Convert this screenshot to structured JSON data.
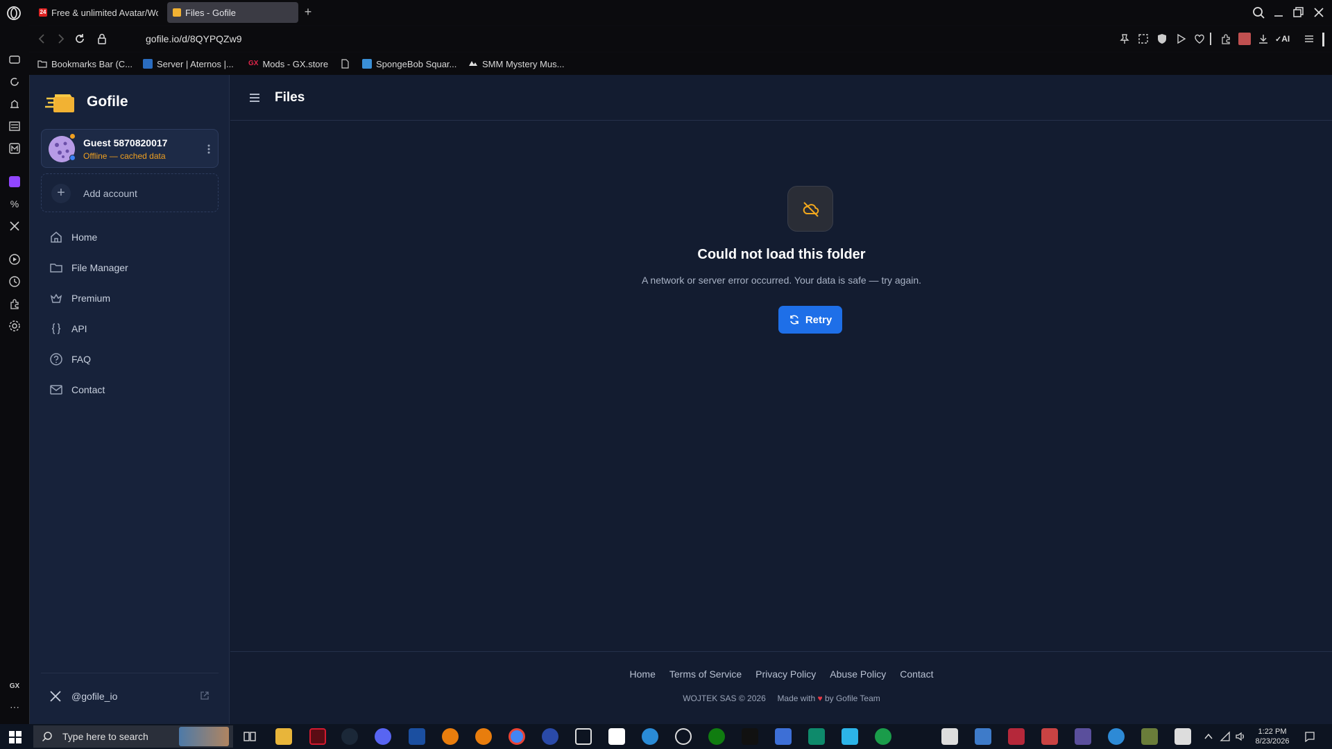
{
  "browser": {
    "tabs": [
      {
        "label": "Free & unlimited Avatar/Wo",
        "badge": "24"
      },
      {
        "label": "Files - Gofile"
      }
    ],
    "new_tab_label": "+",
    "url": "gofile.io/d/8QYPQZw9",
    "bookmarks": [
      "Bookmarks Bar (C...",
      "Server | Aternos |...",
      "Mods - GX.store",
      "",
      "SpongeBob Squar...",
      "SMM Mystery Mus..."
    ],
    "gx_prefix": "GX",
    "ai_label": "AI"
  },
  "app": {
    "brand": "Gofile",
    "account": {
      "name": "Guest 5870820017",
      "status": "Offline — cached data"
    },
    "add_account": "Add account",
    "nav": [
      "Home",
      "File Manager",
      "Premium",
      "API",
      "FAQ",
      "Contact"
    ],
    "social": "@gofile_io"
  },
  "main": {
    "title": "Files",
    "error": {
      "title": "Could not load this folder",
      "message": "A network or server error occurred. Your data is safe — try again.",
      "retry": "Retry"
    },
    "footer": {
      "links": [
        "Home",
        "Terms of Service",
        "Privacy Policy",
        "Abuse Policy",
        "Contact"
      ],
      "copyright": "WOJTEK SAS © 2026",
      "made_with": "Made with",
      "by": "by Gofile Team"
    }
  },
  "taskbar": {
    "search_placeholder": "Type here to search",
    "time": "1:22 PM",
    "date": "8/23/2026"
  },
  "sidebar_strip": {
    "gx": "GX"
  },
  "colors": {
    "accent": "#1e6fe8",
    "warning": "#f0a020",
    "bg": "#131c30",
    "nav_bg": "#17223a"
  }
}
